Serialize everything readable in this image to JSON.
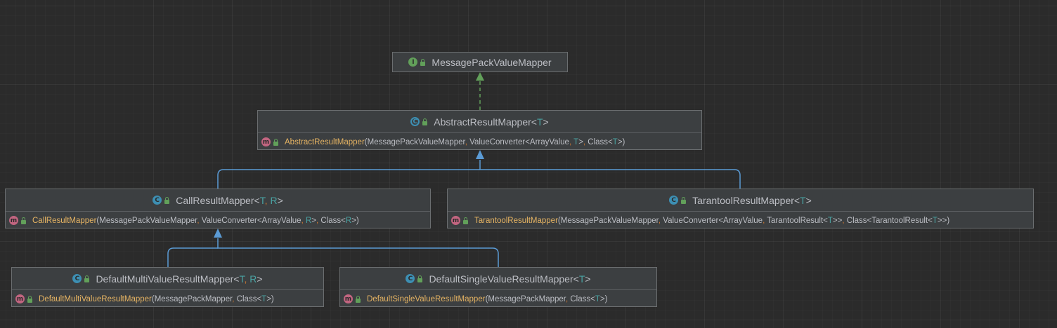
{
  "diagram": {
    "nodes": [
      {
        "id": "message-pack-value-mapper",
        "kind": "interface",
        "kind_letter": "I",
        "title": [
          {
            "t": "MessagePackValueMapper"
          }
        ],
        "members": []
      },
      {
        "id": "abstract-result-mapper",
        "kind": "abstract",
        "kind_letter": "C",
        "title": [
          {
            "t": "AbstractResultMapper<"
          },
          {
            "t": "T",
            "c": "tp"
          },
          {
            "t": ">"
          }
        ],
        "members": [
          {
            "kind_letter": "m",
            "name": "AbstractResultMapper",
            "params": [
              {
                "t": "(MessagePackValueMapper"
              },
              {
                "t": ", ",
                "c": "comma"
              },
              {
                "t": "ValueConverter<ArrayValue"
              },
              {
                "t": ", ",
                "c": "comma"
              },
              {
                "t": "T",
                "c": "tp"
              },
              {
                "t": ">"
              },
              {
                "t": ", ",
                "c": "comma"
              },
              {
                "t": "Class<"
              },
              {
                "t": "T",
                "c": "tp"
              },
              {
                "t": ">)"
              }
            ]
          }
        ]
      },
      {
        "id": "call-result-mapper",
        "kind": "class",
        "kind_letter": "C",
        "title": [
          {
            "t": "CallResultMapper<"
          },
          {
            "t": "T",
            "c": "tp"
          },
          {
            "t": ", ",
            "c": "comma"
          },
          {
            "t": "R",
            "c": "tp"
          },
          {
            "t": ">"
          }
        ],
        "members": [
          {
            "kind_letter": "m",
            "name": "CallResultMapper",
            "params": [
              {
                "t": "(MessagePackValueMapper"
              },
              {
                "t": ", ",
                "c": "comma"
              },
              {
                "t": "ValueConverter<ArrayValue"
              },
              {
                "t": ", ",
                "c": "comma"
              },
              {
                "t": "R",
                "c": "tp"
              },
              {
                "t": ">"
              },
              {
                "t": ", ",
                "c": "comma"
              },
              {
                "t": "Class<"
              },
              {
                "t": "R",
                "c": "tp"
              },
              {
                "t": ">)"
              }
            ]
          }
        ]
      },
      {
        "id": "tarantool-result-mapper",
        "kind": "class",
        "kind_letter": "C",
        "title": [
          {
            "t": "TarantoolResultMapper<"
          },
          {
            "t": "T",
            "c": "tp"
          },
          {
            "t": ">"
          }
        ],
        "members": [
          {
            "kind_letter": "m",
            "name": "TarantoolResultMapper",
            "params": [
              {
                "t": "(MessagePackValueMapper"
              },
              {
                "t": ", ",
                "c": "comma"
              },
              {
                "t": "ValueConverter<ArrayValue"
              },
              {
                "t": ", ",
                "c": "comma"
              },
              {
                "t": "TarantoolResult<"
              },
              {
                "t": "T",
                "c": "tp"
              },
              {
                "t": ">>"
              },
              {
                "t": ", ",
                "c": "comma"
              },
              {
                "t": "Class<TarantoolResult<"
              },
              {
                "t": "T",
                "c": "tp"
              },
              {
                "t": ">>)"
              }
            ]
          }
        ]
      },
      {
        "id": "default-multi-value-result-mapper",
        "kind": "class",
        "kind_letter": "C",
        "title": [
          {
            "t": "DefaultMultiValueResultMapper<"
          },
          {
            "t": "T",
            "c": "tp"
          },
          {
            "t": ", ",
            "c": "comma"
          },
          {
            "t": "R",
            "c": "tp"
          },
          {
            "t": ">"
          }
        ],
        "members": [
          {
            "kind_letter": "m",
            "name": "DefaultMultiValueResultMapper",
            "params": [
              {
                "t": "(MessagePackMapper"
              },
              {
                "t": ", ",
                "c": "comma"
              },
              {
                "t": "Class<"
              },
              {
                "t": "T",
                "c": "tp"
              },
              {
                "t": ">)"
              }
            ]
          }
        ]
      },
      {
        "id": "default-single-value-result-mapper",
        "kind": "class",
        "kind_letter": "C",
        "title": [
          {
            "t": "DefaultSingleValueResultMapper<"
          },
          {
            "t": "T",
            "c": "tp"
          },
          {
            "t": ">"
          }
        ],
        "members": [
          {
            "kind_letter": "m",
            "name": "DefaultSingleValueResultMapper",
            "params": [
              {
                "t": "(MessagePackMapper"
              },
              {
                "t": ", ",
                "c": "comma"
              },
              {
                "t": "Class<"
              },
              {
                "t": "T",
                "c": "tp"
              },
              {
                "t": ">)"
              }
            ]
          }
        ]
      }
    ],
    "edges": [
      {
        "from": "abstract-result-mapper",
        "to": "message-pack-value-mapper",
        "type": "implements"
      },
      {
        "from": "call-result-mapper",
        "to": "abstract-result-mapper",
        "type": "extends"
      },
      {
        "from": "tarantool-result-mapper",
        "to": "abstract-result-mapper",
        "type": "extends"
      },
      {
        "from": "default-multi-value-result-mapper",
        "to": "call-result-mapper",
        "type": "extends"
      },
      {
        "from": "default-single-value-result-mapper",
        "to": "call-result-mapper",
        "type": "extends"
      }
    ],
    "colors": {
      "background": "#2b2b2b",
      "node_fill": "#3c3f41",
      "node_border": "#6b6e70",
      "extends_edge": "#5b9bd5",
      "implements_edge": "#62a05a",
      "type_param": "#4aa3a3",
      "method_name": "#e6b463",
      "separator": "#cc7832"
    }
  }
}
